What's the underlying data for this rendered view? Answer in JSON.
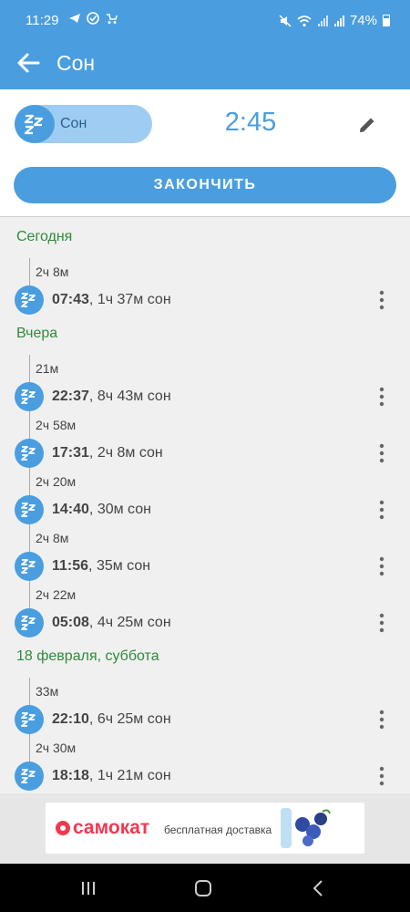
{
  "status_bar": {
    "time": "11:29",
    "battery": "74%",
    "left_icons": [
      "telegram-icon",
      "check-circle-icon",
      "stroller-icon"
    ],
    "right_icons": [
      "mute-icon",
      "wifi-icon",
      "signal-icon",
      "signal-icon",
      "battery-icon"
    ]
  },
  "app_bar": {
    "title": "Сон"
  },
  "session": {
    "toggle_label": "Сон",
    "timer": "2:45",
    "finish_label": "ЗАКОНЧИТЬ"
  },
  "days": [
    {
      "label": "Сегодня",
      "entries": [
        {
          "gap": "2ч 8м",
          "time": "07:43",
          "detail": ", 1ч 37м сон"
        }
      ]
    },
    {
      "label": "Вчера",
      "entries": [
        {
          "gap": "21м",
          "time": "22:37",
          "detail": ", 8ч 43м сон"
        },
        {
          "gap": "2ч 58м",
          "time": "17:31",
          "detail": ", 2ч 8м сон"
        },
        {
          "gap": "2ч 20м",
          "time": "14:40",
          "detail": ", 30м сон"
        },
        {
          "gap": "2ч 8м",
          "time": "11:56",
          "detail": ", 35м сон"
        },
        {
          "gap": "2ч 22м",
          "time": "05:08",
          "detail": ", 4ч 25м сон"
        }
      ]
    },
    {
      "label": "18 февраля, суббота",
      "entries": [
        {
          "gap": "33м",
          "time": "22:10",
          "detail": ", 6ч 25м сон"
        },
        {
          "gap": "2ч 30м",
          "time": "18:18",
          "detail": ", 1ч 21м сон"
        }
      ]
    }
  ],
  "ad": {
    "brand": "самокат",
    "tagline": "бесплатная доставка"
  },
  "colors": {
    "accent": "#4a9ee0",
    "day_header": "#2e8b3a",
    "ad_brand": "#f23850"
  }
}
